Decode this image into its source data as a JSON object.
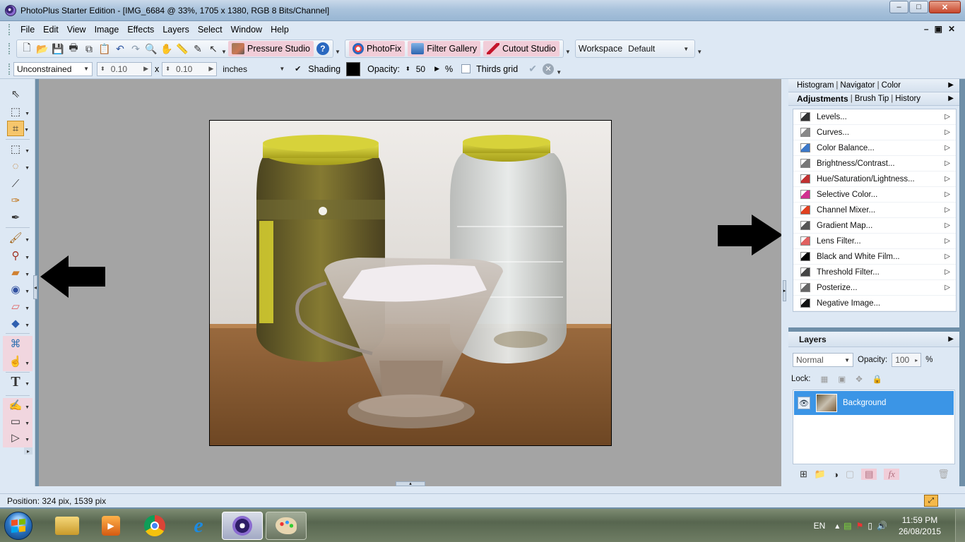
{
  "window": {
    "title": "PhotoPlus Starter Edition - [IMG_6684 @ 33%, 1705 x 1380, RGB 8 Bits/Channel]",
    "minimize": "–",
    "maximize": "□",
    "close": "✕"
  },
  "menu": {
    "items": [
      "File",
      "Edit",
      "View",
      "Image",
      "Effects",
      "Layers",
      "Select",
      "Window",
      "Help"
    ],
    "mdi": [
      "–",
      "▣",
      "✕"
    ]
  },
  "toolbar": {
    "pressure_studio": "Pressure Studio",
    "photofix": "PhotoFix",
    "filter_gallery": "Filter Gallery",
    "cutout_studio": "Cutout Studio",
    "workspace_label": "Workspace",
    "workspace_value": "Default",
    "help_glyph": "?"
  },
  "context_bar": {
    "mode": "Unconstrained",
    "width": "0.10",
    "times": "x",
    "height": "0.10",
    "units": "inches",
    "shading_checked": "✔",
    "shading_label": "Shading",
    "opacity_label": "Opacity:",
    "opacity_value": "50",
    "percent": "%",
    "thirds_label": "Thirds grid"
  },
  "panels": {
    "top_tabs": [
      "Histogram",
      "Navigator",
      "Color"
    ],
    "mid_tabs": [
      "Adjustments",
      "Brush Tip",
      "History"
    ],
    "adjustments": [
      {
        "label": "Levels...",
        "icon": "levels-icon",
        "color": "#333333"
      },
      {
        "label": "Curves...",
        "icon": "curves-icon",
        "color": "#888888"
      },
      {
        "label": "Color Balance...",
        "icon": "color-balance-icon",
        "color": "#3c78c8"
      },
      {
        "label": "Brightness/Contrast...",
        "icon": "brightness-icon",
        "color": "#777777"
      },
      {
        "label": "Hue/Saturation/Lightness...",
        "icon": "hue-saturation-icon",
        "color": "#c03030"
      },
      {
        "label": "Selective Color...",
        "icon": "selective-color-icon",
        "color": "#d03090"
      },
      {
        "label": "Channel Mixer...",
        "icon": "channel-mixer-icon",
        "color": "#e04020"
      },
      {
        "label": "Gradient Map...",
        "icon": "gradient-map-icon",
        "color": "#555555"
      },
      {
        "label": "Lens Filter...",
        "icon": "lens-filter-icon",
        "color": "#e06060"
      },
      {
        "label": "Black and White Film...",
        "icon": "black-white-icon",
        "color": "#000000"
      },
      {
        "label": "Threshold Filter...",
        "icon": "threshold-icon",
        "color": "#444444"
      },
      {
        "label": "Posterize...",
        "icon": "posterize-icon",
        "color": "#666666"
      },
      {
        "label": "Negative Image...",
        "icon": "negative-icon",
        "color": "#111111"
      }
    ],
    "layers": {
      "title": "Layers",
      "blend_mode": "Normal",
      "opacity_label": "Opacity:",
      "opacity_value": "100",
      "percent": "%",
      "lock_label": "Lock:",
      "background_layer": "Background"
    }
  },
  "status": {
    "position": "Position: 324 pix, 1539 pix"
  },
  "taskbar": {
    "lang": "EN",
    "time": "11:59 PM",
    "date": "26/08/2015"
  }
}
